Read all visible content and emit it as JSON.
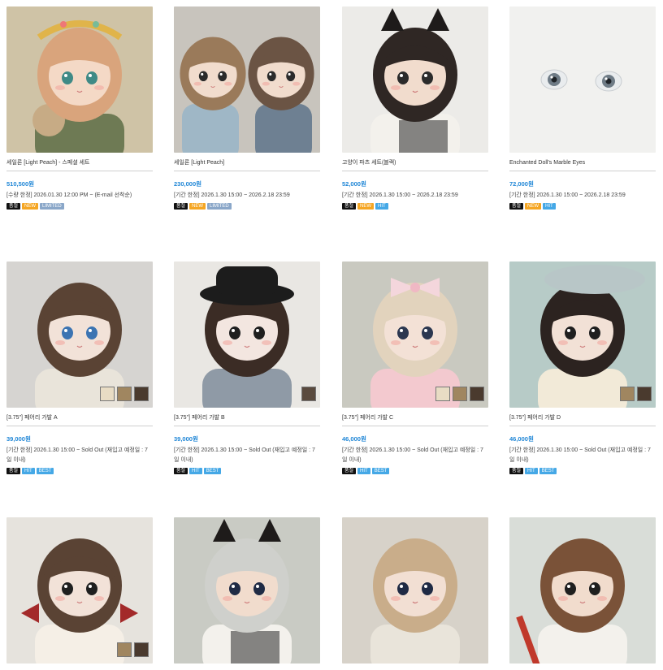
{
  "products": [
    {
      "name": "세일론 [Light Peach] - 스페셜 세트",
      "price": "510,500원",
      "desc": "[수량 한정] 2026.01.30 12:00 PM ~ (E-mail 선착순)",
      "badges": [
        {
          "t": "품절",
          "c": "black"
        },
        {
          "t": "NEW",
          "c": "new"
        },
        {
          "t": "LIMITED",
          "c": "limited"
        }
      ],
      "image": "doll-peach-headband",
      "swatches": []
    },
    {
      "name": "세일론 [Light Peach]",
      "price": "230,000원",
      "desc": "[기간 한정] 2026.1.30 15:00 ~ 2026.2.18 23:59",
      "badges": [
        {
          "t": "품절",
          "c": "black"
        },
        {
          "t": "NEW",
          "c": "new"
        },
        {
          "t": "LIMITED",
          "c": "limited"
        }
      ],
      "image": "two-dolls",
      "swatches": []
    },
    {
      "name": "고양이 파츠 세트(블랙)",
      "price": "52,000원",
      "desc": "[기간 한정] 2026.1.30 15:00 ~ 2026.2.18 23:59",
      "badges": [
        {
          "t": "품절",
          "c": "black"
        },
        {
          "t": "NEW",
          "c": "new"
        },
        {
          "t": "HIT",
          "c": "hit"
        }
      ],
      "image": "doll-cat-ears",
      "swatches": []
    },
    {
      "name": "Enchanted Doll's Marble Eyes",
      "price": "72,000원",
      "desc": "[기간 한정] 2026.1.30 15:00 ~ 2026.2.18 23:59",
      "badges": [
        {
          "t": "품절",
          "c": "black"
        },
        {
          "t": "NEW",
          "c": "new"
        },
        {
          "t": "HIT",
          "c": "hit"
        }
      ],
      "image": "marble-eyes",
      "swatches": []
    },
    {
      "name": "[3.75\"] 페어리 가발 A",
      "price": "39,000원",
      "desc": "[기간 한정] 2026.1.30 15:00 ~ Sold Out (재입고 예정일 : 7일 이내)",
      "badges": [
        {
          "t": "품절",
          "c": "black"
        },
        {
          "t": "HIT",
          "c": "hit"
        },
        {
          "t": "BEST",
          "c": "best"
        }
      ],
      "image": "doll-bob-brown",
      "swatches": [
        "#e8dcc4",
        "#a08660",
        "#4a3a2e"
      ]
    },
    {
      "name": "[3.75\"] 페어리 가발 B",
      "price": "39,000원",
      "desc": "[기간 한정] 2026.1.30 15:00 ~ Sold Out (재입고 예정일 : 7일 이내)",
      "badges": [
        {
          "t": "품절",
          "c": "black"
        },
        {
          "t": "HIT",
          "c": "hit"
        },
        {
          "t": "BEST",
          "c": "best"
        }
      ],
      "image": "doll-hat",
      "swatches": [
        "#5a4a3e"
      ]
    },
    {
      "name": "[3.75\"] 페어리 가발 C",
      "price": "46,000원",
      "desc": "[기간 한정] 2026.1.30 15:00 ~ Sold Out (재입고 예정일 : 7일 이내)",
      "badges": [
        {
          "t": "품절",
          "c": "black"
        },
        {
          "t": "HIT",
          "c": "hit"
        },
        {
          "t": "BEST",
          "c": "best"
        }
      ],
      "image": "doll-blonde-bow",
      "swatches": [
        "#e8dcc4",
        "#a08660",
        "#4a3a2e"
      ]
    },
    {
      "name": "[3.75\"] 페어리 가발 D",
      "price": "46,000원",
      "desc": "[기간 한정] 2026.1.30 15:00 ~ Sold Out (재입고 예정일 : 7일 이내)",
      "badges": [
        {
          "t": "품절",
          "c": "black"
        },
        {
          "t": "HIT",
          "c": "hit"
        },
        {
          "t": "BEST",
          "c": "best"
        }
      ],
      "image": "doll-long-dark",
      "swatches": [
        "#a08660",
        "#4a3a2e"
      ]
    },
    {
      "name": "",
      "price": "",
      "desc": "",
      "badges": [],
      "image": "doll-red-bows",
      "swatches": [
        "#a08660",
        "#4a3a2e"
      ]
    },
    {
      "name": "",
      "price": "",
      "desc": "",
      "badges": [],
      "image": "doll-silver-cat",
      "swatches": []
    },
    {
      "name": "",
      "price": "",
      "desc": "",
      "badges": [],
      "image": "doll-blonde-curls",
      "swatches": []
    },
    {
      "name": "",
      "price": "",
      "desc": "",
      "badges": [],
      "image": "doll-pencil",
      "swatches": []
    }
  ]
}
